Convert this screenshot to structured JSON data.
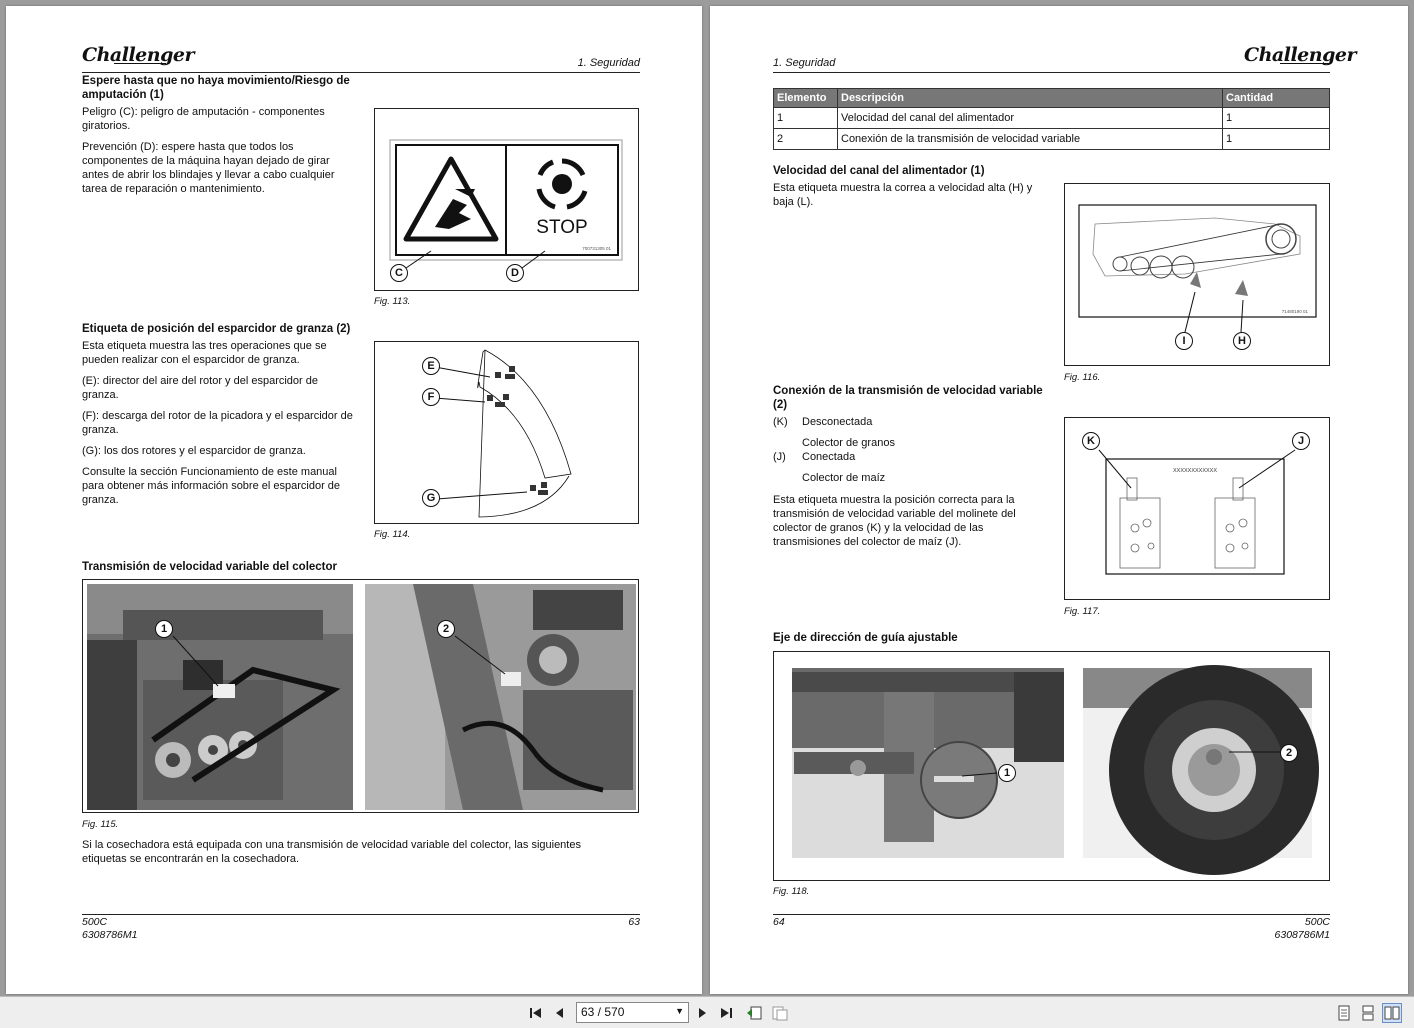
{
  "left_page": {
    "logo": "Challenger",
    "section": "1. Seguridad",
    "s1": {
      "heading": "Espere hasta que no haya movimiento/Riesgo de amputación (1)",
      "p1": "Peligro (C): peligro de amputación - componentes giratorios.",
      "p2": "Prevención (D): espere hasta que todos los componentes de la máquina hayan dejado de girar antes de abrir los blindajes y llevar a cabo cualquier tarea de reparación o mantenimiento.",
      "fig_caption": "Fig. 113.",
      "stop_text": "STOP",
      "part_no": "700731305 01",
      "callouts": [
        "C",
        "D"
      ]
    },
    "s2": {
      "heading": "Etiqueta de posición del esparcidor de granza (2)",
      "p1": "Esta etiqueta muestra las tres operaciones que se pueden realizar con el esparcidor de granza.",
      "p2": "(E): director del aire del rotor y del esparcidor de granza.",
      "p3": "(F): descarga del rotor de la picadora y el esparcidor de granza.",
      "p4": "(G): los dos rotores y el esparcidor de granza.",
      "p5": "Consulte la sección Funcionamiento de este manual para obtener más información sobre el esparcidor de granza.",
      "fig_caption": "Fig. 114.",
      "callouts": [
        "E",
        "F",
        "G"
      ]
    },
    "s3": {
      "heading": "Transmisión de velocidad variable del colector",
      "fig_caption": "Fig. 115.",
      "callouts": [
        "1",
        "2"
      ],
      "p1": "Si la cosechadora está equipada con una transmisión de velocidad variable del colector, las siguientes etiquetas se encontrarán en la cosechadora."
    },
    "footer": {
      "model": "500C",
      "doc": "6308786M1",
      "page": "63"
    }
  },
  "right_page": {
    "logo": "Challenger",
    "section": "1. Seguridad",
    "table": {
      "headers": [
        "Elemento",
        "Descripción",
        "Cantidad"
      ],
      "rows": [
        [
          "1",
          "Velocidad del canal del alimentador",
          "1"
        ],
        [
          "2",
          "Conexión de la transmisión de velocidad variable",
          "1"
        ]
      ]
    },
    "s1": {
      "heading": "Velocidad del canal del alimentador (1)",
      "p1": "Esta etiqueta muestra la correa a velocidad alta (H) y baja (L).",
      "fig_caption": "Fig. 116.",
      "part_no": "71480190 01",
      "callouts": [
        "I",
        "H"
      ]
    },
    "s2": {
      "heading": "Conexión de la transmisión de velocidad variable (2)",
      "k_label": "(K)",
      "k1": "Desconectada",
      "k2": "Colector de granos",
      "j_label": "(J)",
      "j1": "Conectada",
      "j2": "Colector de maíz",
      "p1": "Esta etiqueta muestra la posición correcta para la transmisión de velocidad variable del molinete del colector de granos (K) y la velocidad de las transmisiones del colector de maíz (J).",
      "fig_caption": "Fig. 117.",
      "xs": "XXXXXXXXXXXX",
      "callouts": [
        "K",
        "J"
      ]
    },
    "s3": {
      "heading": "Eje de dirección de guía ajustable",
      "fig_caption": "Fig. 118.",
      "callouts": [
        "1",
        "2"
      ]
    },
    "footer": {
      "page": "64",
      "model": "500C",
      "doc": "6308786M1"
    }
  },
  "toolbar": {
    "page_indicator": "63 / 570",
    "icons": [
      "first-page-icon",
      "prev-page-icon",
      "next-page-icon",
      "last-page-icon",
      "go-back-icon",
      "go-forward-icon",
      "single-page-icon",
      "continuous-page-icon",
      "facing-pages-icon"
    ]
  }
}
